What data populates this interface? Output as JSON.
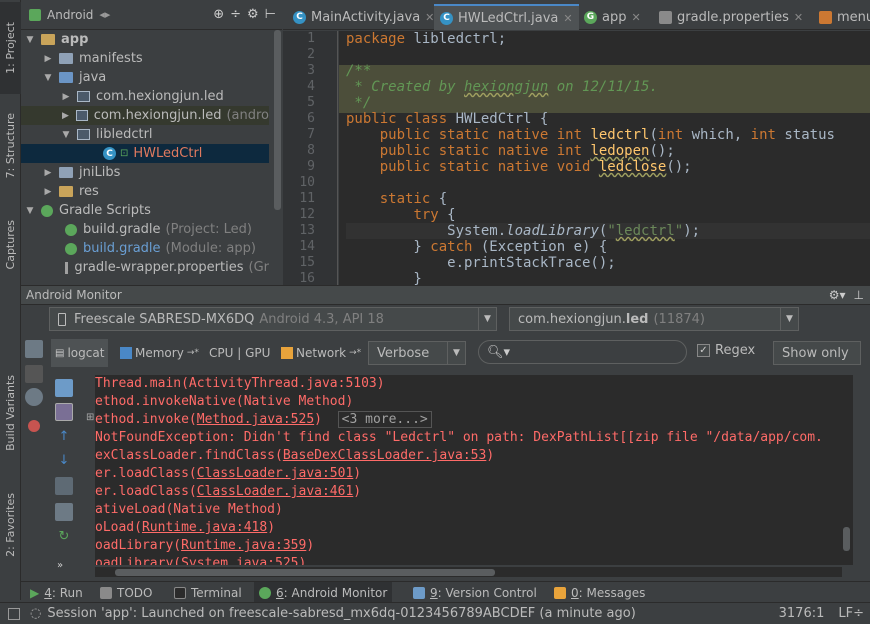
{
  "left_stripe": {
    "tabs": [
      "1: Project",
      "7: Structure",
      "Captures",
      "Build Variants",
      "2: Favorites"
    ]
  },
  "project": {
    "view_selector": "Android",
    "tree": [
      {
        "label": "app",
        "extra": ""
      },
      {
        "label": "manifests",
        "extra": ""
      },
      {
        "label": "java",
        "extra": ""
      },
      {
        "label": "com.hexiongjun.led",
        "extra": ""
      },
      {
        "label": "com.hexiongjun.led",
        "extra": "(andro"
      },
      {
        "label": "libledctrl",
        "extra": ""
      },
      {
        "label": "HWLedCtrl",
        "extra": ""
      },
      {
        "label": "jniLibs",
        "extra": ""
      },
      {
        "label": "res",
        "extra": ""
      },
      {
        "label": "Gradle Scripts",
        "extra": ""
      },
      {
        "label": "build.gradle",
        "extra": "(Project: Led)"
      },
      {
        "label": "build.gradle",
        "extra": "(Module: app)"
      },
      {
        "label": "gradle-wrapper.properties",
        "extra": "(Gr"
      }
    ]
  },
  "editor": {
    "tabs": [
      "MainActivity.java",
      "HWLedCtrl.java",
      "app",
      "gradle.properties",
      "menu"
    ],
    "line_numbers": [
      "1",
      "2",
      "3",
      "4",
      "5",
      "6",
      "7",
      "8",
      "9",
      "10",
      "11",
      "12",
      "13",
      "14",
      "15",
      "16"
    ]
  },
  "monitor": {
    "title": "Android Monitor",
    "device": "Freescale SABRESD-MX6DQ",
    "device_detail": "Android 4.3, API 18",
    "process": "com.hexiongjun.",
    "process_bold": "led",
    "process_pid": "(11874)",
    "tabs": [
      "logcat",
      "Memory",
      "CPU | GPU",
      "Network"
    ],
    "log_level": "Verbose",
    "search_placeholder": "",
    "regex_label": "Regex",
    "show_only_label": "Show only",
    "log_more": "<3 more...>"
  },
  "bottom_tools": [
    {
      "num": "4",
      "label": "Run"
    },
    {
      "num": "",
      "label": "TODO"
    },
    {
      "num": "",
      "label": "Terminal"
    },
    {
      "num": "6",
      "label": "Android Monitor"
    },
    {
      "num": "9",
      "label": "Version Control"
    },
    {
      "num": "0",
      "label": "Messages"
    }
  ],
  "status": {
    "message": "Session 'app': Launched on freescale-sabresd_mx6dq-0123456789ABCDEF (a minute ago)",
    "position": "3176:1",
    "line_sep": "LF÷"
  },
  "colors": {
    "accent": "#4a88c7",
    "error": "#ff6b68",
    "keyword": "#cc7832",
    "comment": "#629755"
  }
}
